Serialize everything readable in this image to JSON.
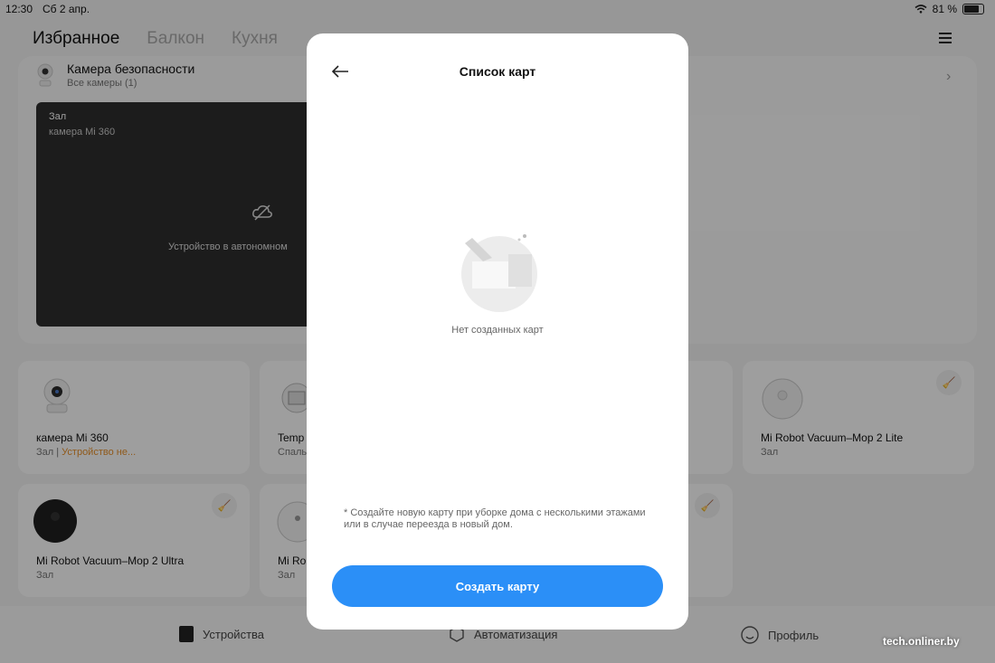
{
  "status_bar": {
    "time": "12:30",
    "date": "Сб 2 апр.",
    "battery": "81 %"
  },
  "header": {
    "tabs": [
      "Избранное",
      "Балкон",
      "Кухня"
    ]
  },
  "camera_section": {
    "title": "Камера безопасности",
    "subtitle": "Все камеры  (1)",
    "video": {
      "room": "Зал",
      "device": "камера Mi 360",
      "status": "Устройство в автономном"
    }
  },
  "tiles": [
    {
      "name": "камера Mi 360",
      "room": "Зал | ",
      "warning": "Устройство не..."
    },
    {
      "name": "Temp",
      "room": "Спаль"
    },
    {
      "name": "Mi Robot Vacuum–Mop 2 Lite",
      "room": "Зал"
    },
    {
      "name": "Mi Robot Vacuum–Mop 2 Ultra",
      "room": "Зал"
    },
    {
      "name": "Mi Ro",
      "room": "Зал"
    }
  ],
  "bottom_nav": {
    "devices": "Устройства",
    "automation": "Автоматизация",
    "profile": "Профиль"
  },
  "watermark": "tech.onliner.by",
  "modal": {
    "title": "Список карт",
    "empty_text": "Нет созданных карт",
    "note": "* Создайте новую карту при уборке дома с несколькими этажами или в случае переезда в новый дом.",
    "create_button": "Создать карту"
  },
  "colors": {
    "accent": "#2b8ff7",
    "warning": "#e8912d"
  }
}
